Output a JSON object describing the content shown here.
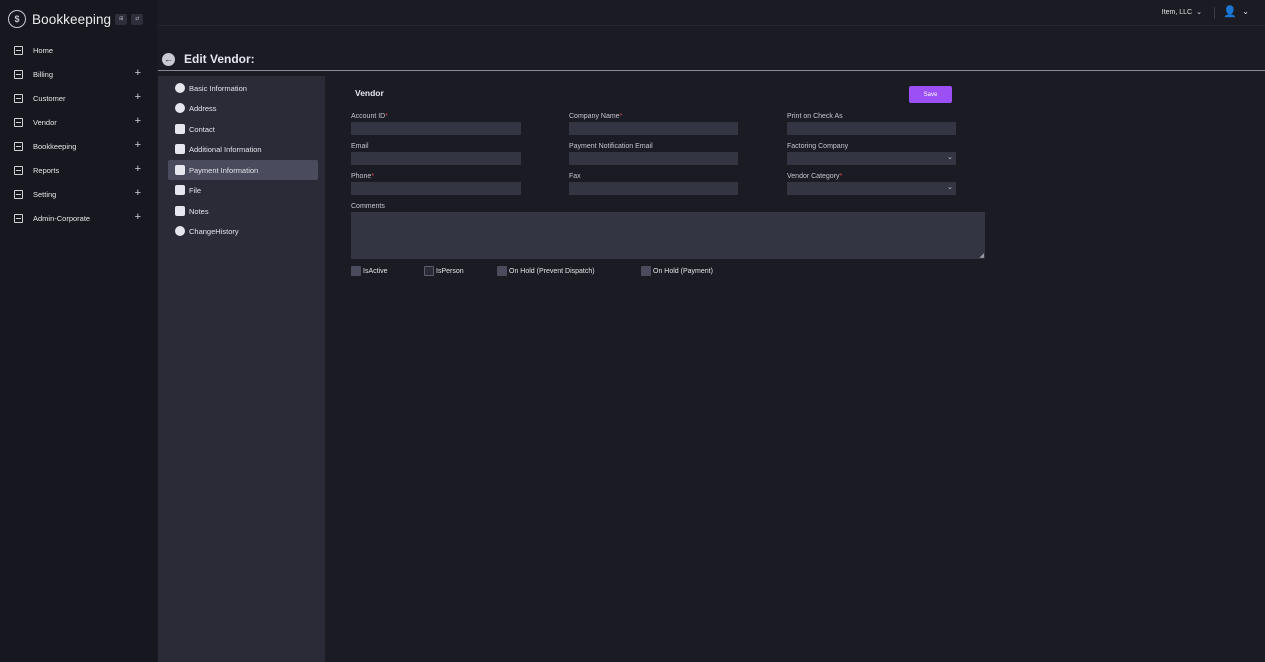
{
  "brand": {
    "name": "Bookkeeping",
    "btn1": "⊞",
    "btn2": "⇄"
  },
  "sidebar": {
    "items": [
      {
        "label": "Home",
        "plus": ""
      },
      {
        "label": "Billing",
        "plus": "+"
      },
      {
        "label": "Customer",
        "plus": "+"
      },
      {
        "label": "Vendor",
        "plus": "+"
      },
      {
        "label": "Bookkeeping",
        "plus": "+"
      },
      {
        "label": "Reports",
        "plus": "+"
      },
      {
        "label": "Setting",
        "plus": "+"
      },
      {
        "label": "Admin-Corporate",
        "plus": "+"
      }
    ]
  },
  "topbar": {
    "company": "Item, LLC",
    "chevron": "⌄",
    "avatar": "👤"
  },
  "page": {
    "title": "Edit Vendor:",
    "back": "←"
  },
  "subnav": {
    "items": [
      {
        "label": "Basic Information"
      },
      {
        "label": "Address"
      },
      {
        "label": "Contact"
      },
      {
        "label": "Additional Information"
      },
      {
        "label": "Payment Information"
      },
      {
        "label": "File"
      },
      {
        "label": "Notes"
      },
      {
        "label": "ChangeHistory"
      }
    ],
    "active_index": 4
  },
  "form": {
    "title": "Vendor",
    "save_label": "Save",
    "fields": {
      "account_id": {
        "label": "Account ID",
        "value": ""
      },
      "company_name": {
        "label": "Company Name",
        "value": ""
      },
      "print_on_check": {
        "label": "Print on Check As",
        "value": ""
      },
      "email": {
        "label": "Email",
        "value": ""
      },
      "payment_email": {
        "label": "Payment Notification Email",
        "value": ""
      },
      "factoring_company": {
        "label": "Factoring Company",
        "value": ""
      },
      "phone": {
        "label": "Phone",
        "value": ""
      },
      "fax": {
        "label": "Fax",
        "value": ""
      },
      "vendor_category": {
        "label": "Vendor Category",
        "value": ""
      },
      "comments": {
        "label": "Comments",
        "value": ""
      }
    },
    "required_mark": "*",
    "checkboxes": {
      "is_active": "IsActive",
      "is_person": "IsPerson",
      "on_hold_dispatch": "On Hold (Prevent Dispatch)",
      "on_hold_payment": "On Hold (Payment)"
    }
  }
}
